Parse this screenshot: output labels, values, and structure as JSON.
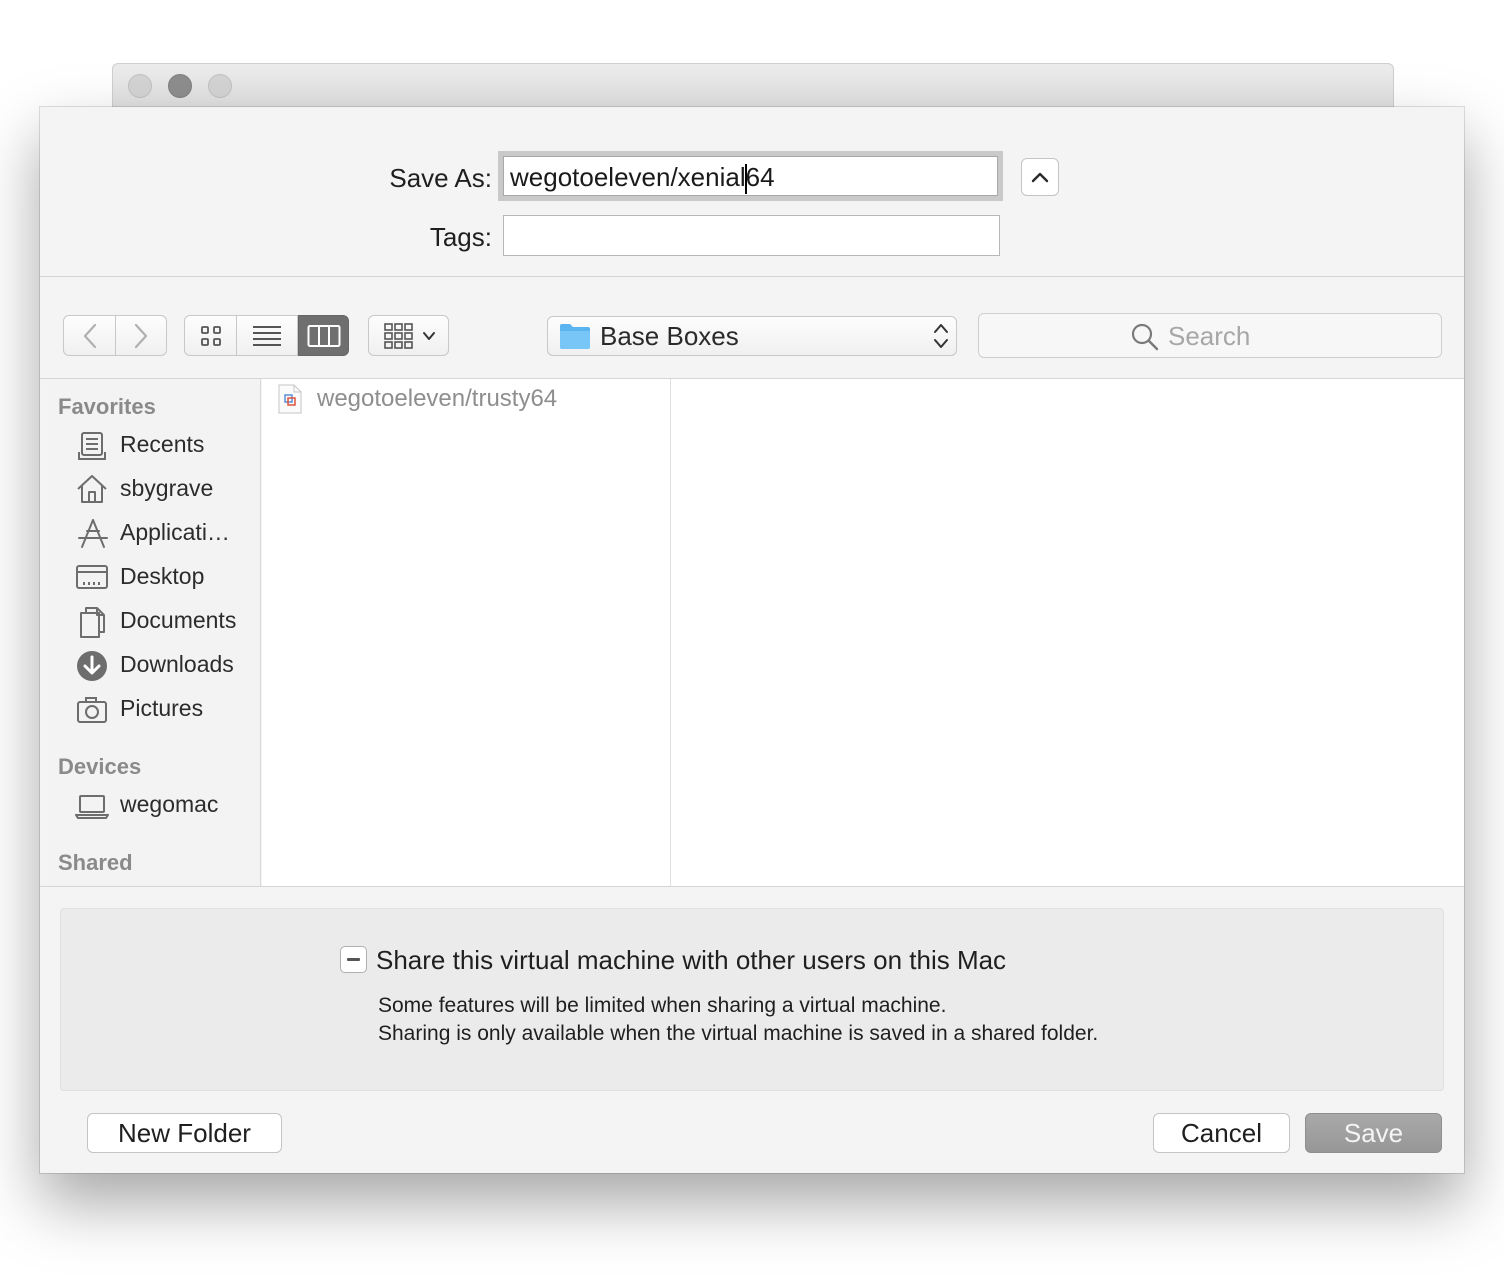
{
  "dialog": {
    "save_as_label": "Save As:",
    "save_as_value_before_cursor": "wegotoeleven/xenial",
    "save_as_value_after_cursor": "64",
    "tags_label": "Tags:",
    "tags_value": ""
  },
  "toolbar": {
    "location": "Base Boxes",
    "search_placeholder": "Search",
    "view_modes": [
      "icon",
      "list",
      "column"
    ],
    "active_view": "column"
  },
  "sidebar": {
    "favorites_header": "Favorites",
    "favorites": [
      {
        "label": "Recents",
        "icon": "recents-icon"
      },
      {
        "label": "sbygrave",
        "icon": "home-icon"
      },
      {
        "label": "Applicati…",
        "icon": "applications-icon"
      },
      {
        "label": "Desktop",
        "icon": "desktop-icon"
      },
      {
        "label": "Documents",
        "icon": "documents-icon"
      },
      {
        "label": "Downloads",
        "icon": "downloads-icon"
      },
      {
        "label": "Pictures",
        "icon": "pictures-icon"
      }
    ],
    "devices_header": "Devices",
    "devices": [
      {
        "label": "wegomac",
        "icon": "laptop-icon"
      }
    ],
    "shared_header": "Shared"
  },
  "browser": {
    "files": [
      {
        "name": "wegotoeleven/trusty64",
        "icon": "vm-file-icon"
      }
    ]
  },
  "accessory": {
    "share_label": "Share this virtual machine with other users on this Mac",
    "share_state": "mixed",
    "note_line1": "Some features will be limited when sharing a virtual machine.",
    "note_line2": "Sharing is only available when the virtual machine is saved in a shared folder."
  },
  "buttons": {
    "new_folder": "New Folder",
    "cancel": "Cancel",
    "save": "Save"
  }
}
